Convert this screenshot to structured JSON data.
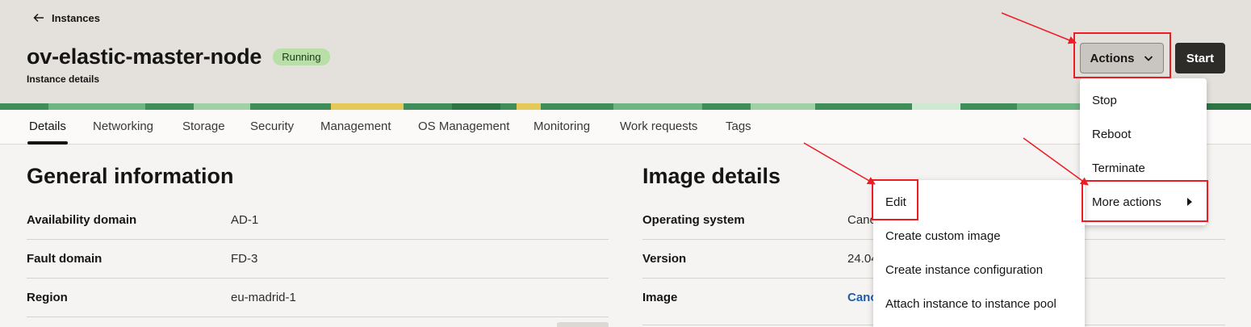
{
  "header": {
    "back_label": "Instances",
    "title": "ov-elastic-master-node",
    "status": "Running",
    "subtitle": "Instance details",
    "actions_label": "Actions",
    "start_label": "Start"
  },
  "tabs": [
    {
      "label": "Details",
      "active": true
    },
    {
      "label": "Networking"
    },
    {
      "label": "Storage"
    },
    {
      "label": "Security"
    },
    {
      "label": "Management"
    },
    {
      "label": "OS Management"
    },
    {
      "label": "Monitoring"
    },
    {
      "label": "Work requests"
    },
    {
      "label": "Tags"
    }
  ],
  "general": {
    "title": "General information",
    "rows": [
      {
        "label": "Availability domain",
        "value": "AD-1"
      },
      {
        "label": "Fault domain",
        "value": "FD-3"
      },
      {
        "label": "Region",
        "value": "eu-madrid-1"
      }
    ]
  },
  "image": {
    "title": "Image details",
    "rows": [
      {
        "label": "Operating system",
        "value": "Cano"
      },
      {
        "label": "Version",
        "value": "24.04"
      },
      {
        "label": "Image",
        "value": "Cano"
      }
    ]
  },
  "actions_menu": {
    "items": [
      "Stop",
      "Reboot",
      "Terminate",
      "More actions"
    ]
  },
  "more_actions_menu": {
    "items": [
      "Edit",
      "Create custom image",
      "Create instance configuration",
      "Attach instance to instance pool"
    ]
  },
  "icons": {
    "back": "arrow-left-icon",
    "actions_caret": "chevron-down-icon",
    "submenu_caret": "caret-right-icon"
  },
  "colors": {
    "annotation": "#ec1b24",
    "status_badge": "#b7dfa7",
    "link": "#1f5fa8",
    "start_button": "#2e2c29"
  }
}
